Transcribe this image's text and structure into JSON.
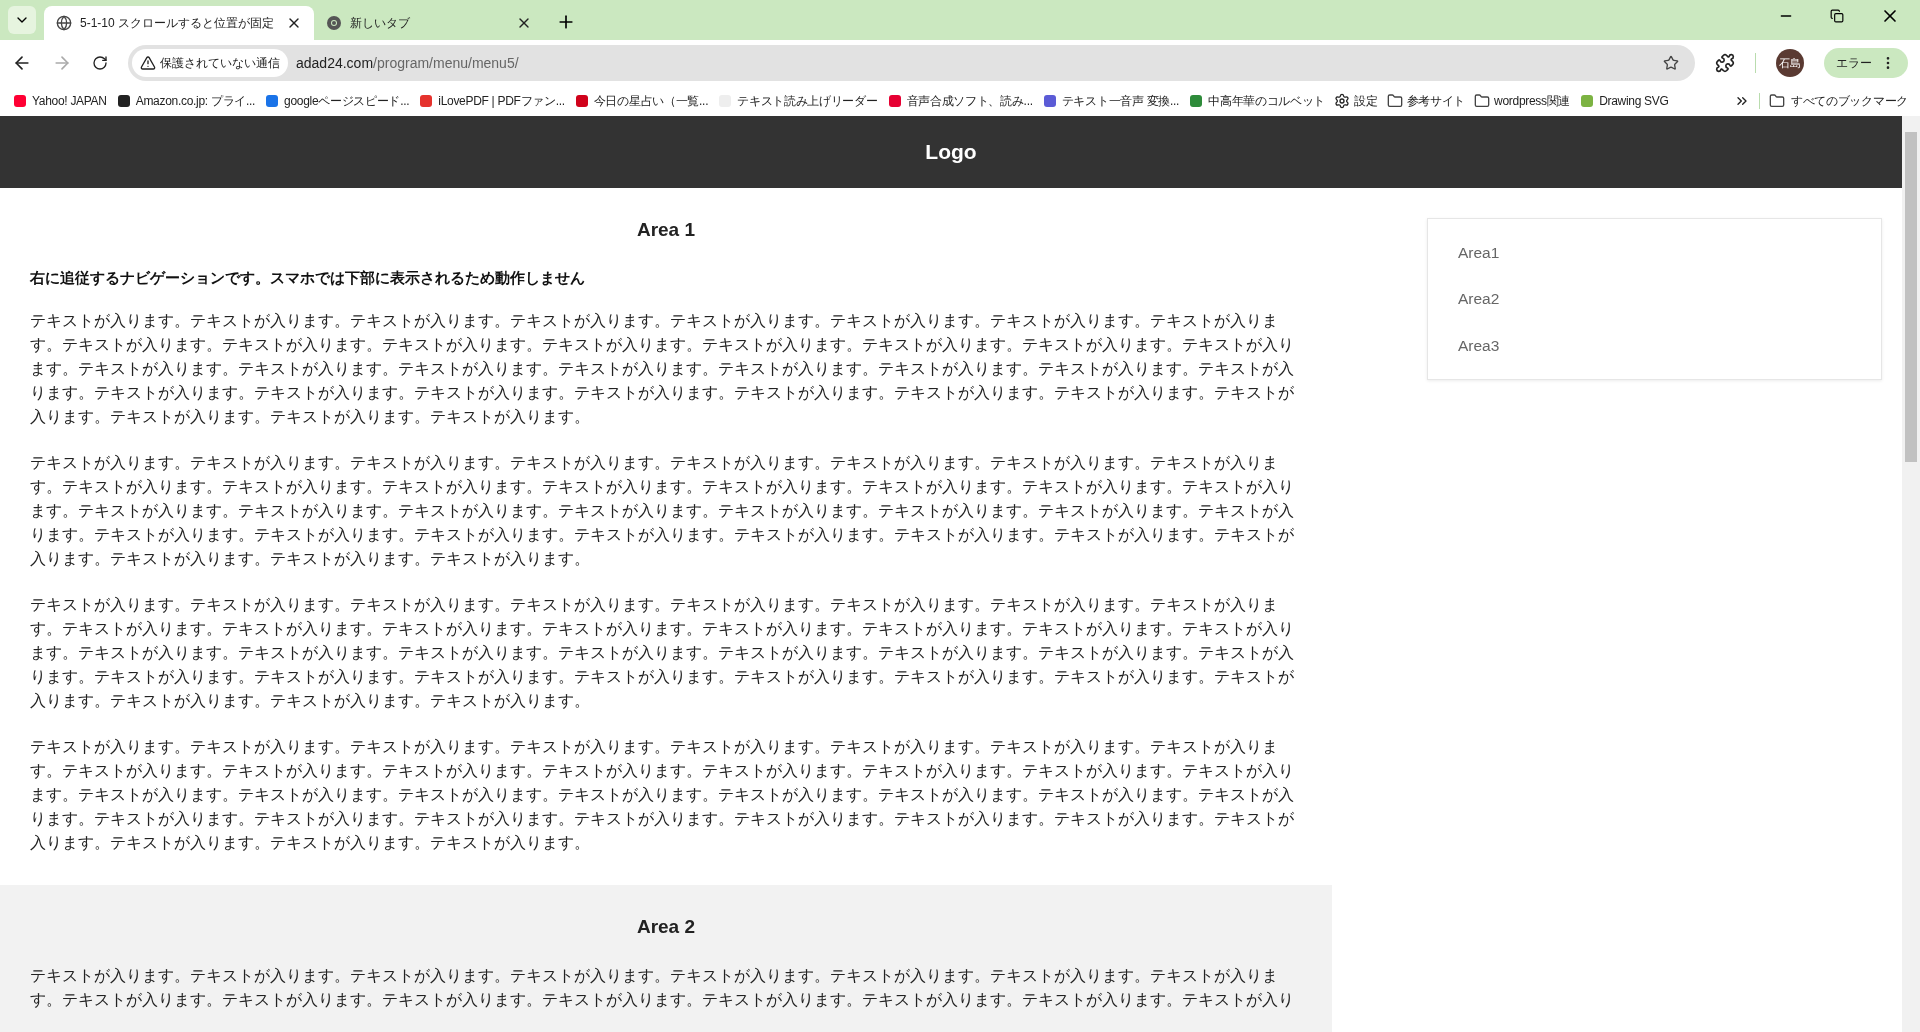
{
  "browser": {
    "tabs": [
      {
        "title": "5-1-10 スクロールすると位置が固定",
        "selected": true
      },
      {
        "title": "新しいタブ",
        "selected": false
      }
    ],
    "address": {
      "security_label": "保護されていない通信",
      "host": "adad24.com",
      "path": "/program/menu/menu5/"
    },
    "profile_initials": "石島",
    "error_label": "エラー",
    "bookmarks": [
      {
        "label": "Yahoo! JAPAN",
        "kind": "site",
        "color": "#ff0033"
      },
      {
        "label": "Amazon.co.jp: プライ...",
        "kind": "site",
        "color": "#222222"
      },
      {
        "label": "googleページスピード...",
        "kind": "site",
        "color": "#1a73e8"
      },
      {
        "label": "iLovePDF | PDFファン...",
        "kind": "site",
        "color": "#e5322d"
      },
      {
        "label": "今日の星占い（一覧...",
        "kind": "site",
        "color": "#d0021b"
      },
      {
        "label": "テキスト読み上げリーダー",
        "kind": "site",
        "color": "#eeeeee"
      },
      {
        "label": "音声合成ソフト、読み...",
        "kind": "site",
        "color": "#e60033"
      },
      {
        "label": "テキスト一音声 変換...",
        "kind": "site",
        "color": "#5b5bd6"
      },
      {
        "label": "中高年華のコルベット",
        "kind": "site",
        "color": "#2e8b3a"
      },
      {
        "label": "設定",
        "kind": "gear"
      },
      {
        "label": "参考サイト",
        "kind": "folder"
      },
      {
        "label": "wordpress関連",
        "kind": "folder"
      },
      {
        "label": "Drawing SVG",
        "kind": "site",
        "color": "#7cb342"
      }
    ],
    "all_bookmarks": "すべてのブックマーク"
  },
  "page": {
    "logo": "Logo",
    "sections": [
      {
        "heading": "Area 1",
        "shaded": false,
        "lead": "右に追従するナビゲーションです。スマホでは下部に表示されるため動作しません",
        "paragraphs": [
          "テキストが入ります。テキストが入ります。テキストが入ります。テキストが入ります。テキストが入ります。テキストが入ります。テキストが入ります。テキストが入ります。テキストが入ります。テキストが入ります。テキストが入ります。テキストが入ります。テキストが入ります。テキストが入ります。テキストが入ります。テキストが入ります。テキストが入ります。テキストが入ります。テキストが入ります。テキストが入ります。テキストが入ります。テキストが入ります。テキストが入ります。テキストが入ります。テキストが入ります。テキストが入ります。テキストが入ります。テキストが入ります。テキストが入ります。テキストが入ります。テキストが入ります。テキストが入ります。テキストが入ります。テキストが入ります。テキストが入ります。",
          "テキストが入ります。テキストが入ります。テキストが入ります。テキストが入ります。テキストが入ります。テキストが入ります。テキストが入ります。テキストが入ります。テキストが入ります。テキストが入ります。テキストが入ります。テキストが入ります。テキストが入ります。テキストが入ります。テキストが入ります。テキストが入ります。テキストが入ります。テキストが入ります。テキストが入ります。テキストが入ります。テキストが入ります。テキストが入ります。テキストが入ります。テキストが入ります。テキストが入ります。テキストが入ります。テキストが入ります。テキストが入ります。テキストが入ります。テキストが入ります。テキストが入ります。テキストが入ります。テキストが入ります。テキストが入ります。テキストが入ります。",
          "テキストが入ります。テキストが入ります。テキストが入ります。テキストが入ります。テキストが入ります。テキストが入ります。テキストが入ります。テキストが入ります。テキストが入ります。テキストが入ります。テキストが入ります。テキストが入ります。テキストが入ります。テキストが入ります。テキストが入ります。テキストが入ります。テキストが入ります。テキストが入ります。テキストが入ります。テキストが入ります。テキストが入ります。テキストが入ります。テキストが入ります。テキストが入ります。テキストが入ります。テキストが入ります。テキストが入ります。テキストが入ります。テキストが入ります。テキストが入ります。テキストが入ります。テキストが入ります。テキストが入ります。テキストが入ります。テキストが入ります。",
          "テキストが入ります。テキストが入ります。テキストが入ります。テキストが入ります。テキストが入ります。テキストが入ります。テキストが入ります。テキストが入ります。テキストが入ります。テキストが入ります。テキストが入ります。テキストが入ります。テキストが入ります。テキストが入ります。テキストが入ります。テキストが入ります。テキストが入ります。テキストが入ります。テキストが入ります。テキストが入ります。テキストが入ります。テキストが入ります。テキストが入ります。テキストが入ります。テキストが入ります。テキストが入ります。テキストが入ります。テキストが入ります。テキストが入ります。テキストが入ります。テキストが入ります。テキストが入ります。テキストが入ります。テキストが入ります。テキストが入ります。"
        ]
      },
      {
        "heading": "Area 2",
        "shaded": true,
        "paragraphs": [
          "テキストが入ります。テキストが入ります。テキストが入ります。テキストが入ります。テキストが入ります。テキストが入ります。テキストが入ります。テキストが入ります。テキストが入ります。テキストが入ります。テキストが入ります。テキストが入ります。テキストが入ります。テキストが入ります。テキストが入ります。テキストが入り"
        ]
      }
    ],
    "side_nav": [
      {
        "label": "Area1"
      },
      {
        "label": "Area2"
      },
      {
        "label": "Area3"
      }
    ]
  }
}
